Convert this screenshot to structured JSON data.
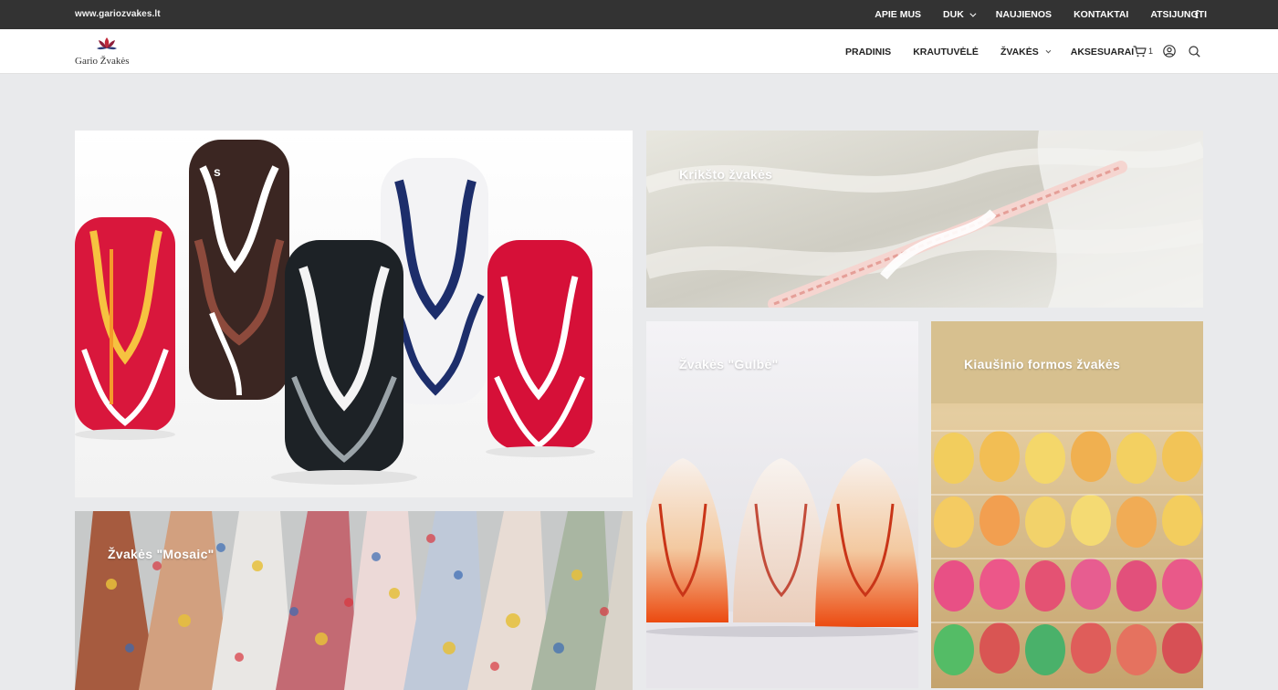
{
  "topbar": {
    "site": "www.gariozvakes.lt",
    "nav": [
      {
        "label": "APIE MUS"
      },
      {
        "label": "DUK"
      },
      {
        "label": "NAUJIENOS"
      },
      {
        "label": "KONTAKTAI"
      },
      {
        "label": "ATSIJUNGTI"
      }
    ],
    "social_icon": "facebook-icon"
  },
  "header": {
    "logo_text": "Gario Žvakės",
    "nav": [
      {
        "label": "PRADINIS"
      },
      {
        "label": "KRAUTUVĖLĖ"
      },
      {
        "label": "ŽVAKĖS"
      },
      {
        "label": "AKSESUARAI"
      }
    ],
    "cart_count": "1",
    "icons": [
      "cart-icon",
      "user-icon",
      "search-icon"
    ]
  },
  "tiles": [
    {
      "label": "s"
    },
    {
      "label": "Krikšto žvakės"
    },
    {
      "label": "Žvakės \"Gulbė\""
    },
    {
      "label": "Kiaušinio formos žvakės"
    },
    {
      "label": "Žvakės \"Mosaic\""
    }
  ],
  "colors": {
    "topbar_bg": "#333333",
    "header_bg": "#ffffff",
    "page_bg": "#e9eaec",
    "text_dark": "#222222"
  }
}
